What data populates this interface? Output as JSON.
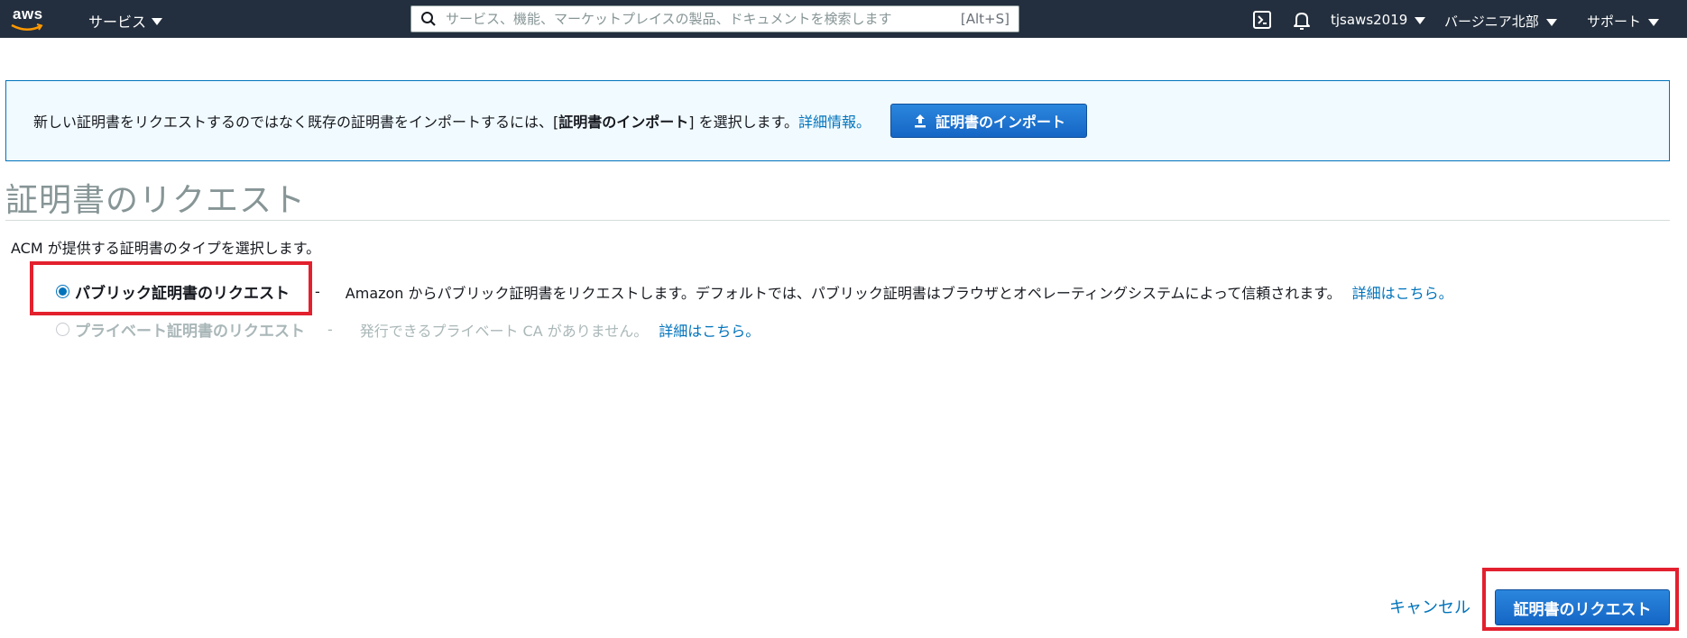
{
  "header": {
    "logo_text": "aws",
    "services_label": "サービス",
    "search_placeholder": "サービス、機能、マーケットプレイスの製品、ドキュメントを検索します",
    "search_shortcut": "[Alt+S]",
    "account_label": "tjsaws2019",
    "region_label": "バージニア北部",
    "support_label": "サポート",
    "icons": [
      "cloudshell-icon",
      "bell-icon"
    ]
  },
  "banner": {
    "text_before": "新しい証明書をリクエストするのではなく既存の証明書をインポートするには、[",
    "text_bold": "証明書のインポート",
    "text_after": "] を選択します。",
    "link_label": "詳細情報。",
    "import_button_label": "証明書のインポート"
  },
  "page": {
    "title": "証明書のリクエスト",
    "description": "ACM が提供する証明書のタイプを選択します。"
  },
  "options": [
    {
      "label": "パブリック証明書のリクエスト",
      "selected": true,
      "disabled": false,
      "separator": "-",
      "description": "Amazon からパブリック証明書をリクエストします。デフォルトでは、パブリック証明書はブラウザとオペレーティングシステムによって信頼されます。",
      "link_label": "詳細はこちら。"
    },
    {
      "label": "プライベート証明書のリクエスト",
      "selected": false,
      "disabled": true,
      "separator": "-",
      "description": "発行できるプライベート CA がありません。",
      "link_label": "詳細はこちら。"
    }
  ],
  "footer": {
    "cancel_label": "キャンセル",
    "request_button_label": "証明書のリクエスト"
  },
  "colors": {
    "nav_bg": "#232f3e",
    "link": "#0073bb",
    "primary_button": "#1f78d1",
    "highlight": "#e3202e",
    "banner_bg": "#f1faff"
  }
}
